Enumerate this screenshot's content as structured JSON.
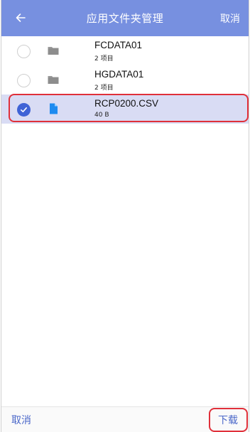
{
  "header": {
    "title": "应用文件夹管理",
    "cancel_label": "取消",
    "back_icon": "arrow-left-icon"
  },
  "files": [
    {
      "name": "FCDATA01",
      "meta": "2 项目",
      "type": "folder",
      "selected": false
    },
    {
      "name": "HGDATA01",
      "meta": "2 项目",
      "type": "folder",
      "selected": false
    },
    {
      "name": "RCP0200.CSV",
      "meta": "40 B",
      "type": "file",
      "selected": true
    }
  ],
  "footer": {
    "cancel_label": "取消",
    "download_label": "下载"
  },
  "colors": {
    "header_bg": "#7790e0",
    "selected_row_bg": "#d9dcf4",
    "accent": "#3f63d6",
    "highlight_outline": "#e0303a",
    "folder_icon": "#9a9a9a",
    "file_icon": "#1e8bf0"
  }
}
